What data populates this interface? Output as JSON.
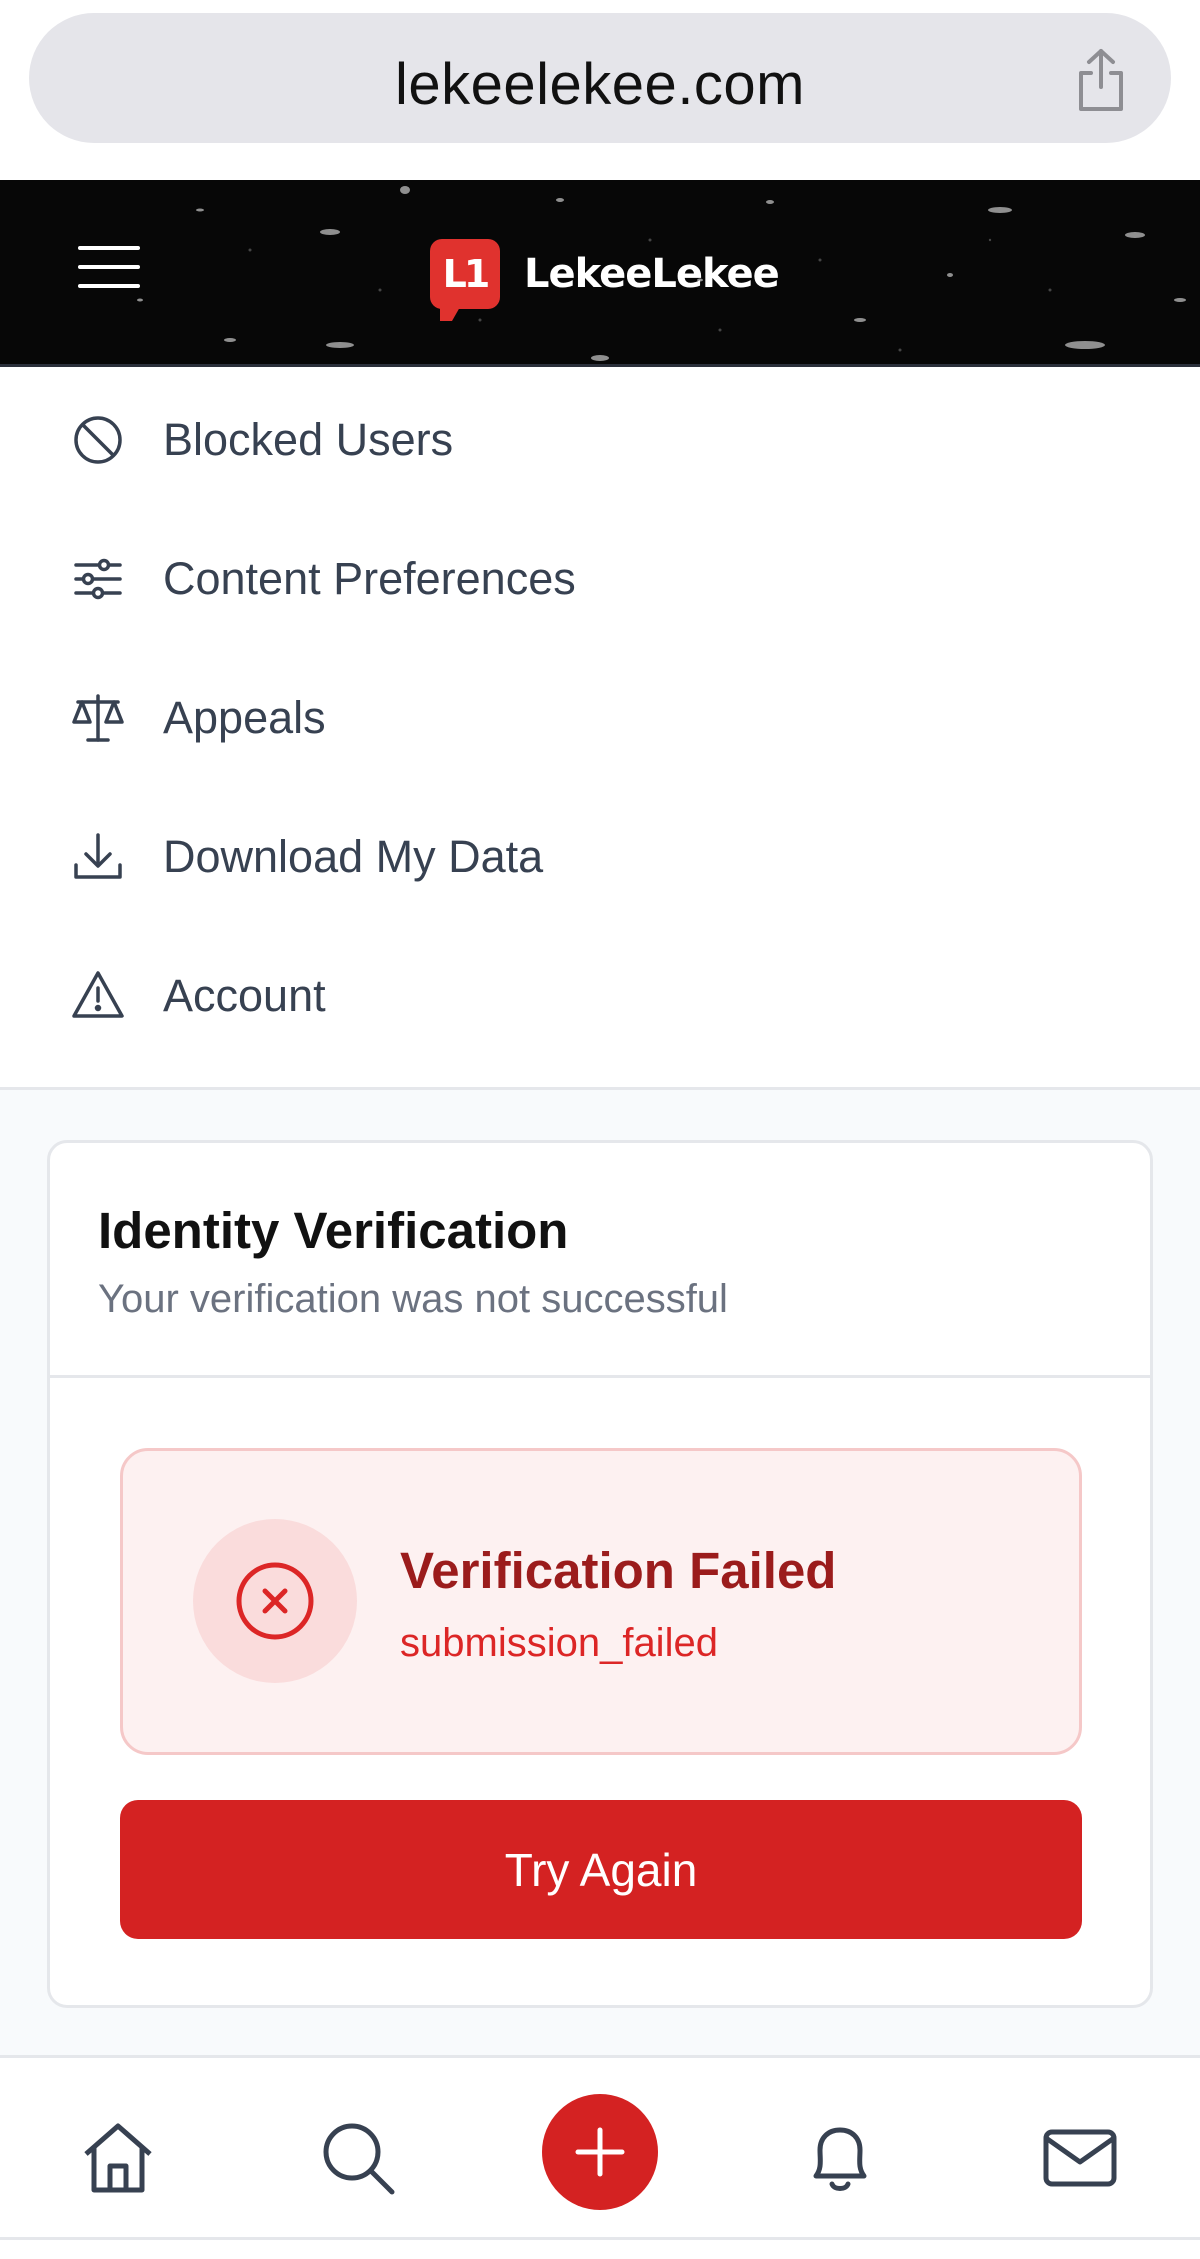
{
  "browser": {
    "url": "lekeelekee.com",
    "share_icon": "share-icon"
  },
  "header": {
    "menu_icon": "hamburger-icon",
    "logo_text": "LekeeLekee",
    "background": "#070707",
    "brand_color": "#e0322e"
  },
  "menu": {
    "items": [
      {
        "label": "Blocked Users",
        "icon": "block-icon"
      },
      {
        "label": "Content Preferences",
        "icon": "sliders-icon"
      },
      {
        "label": "Appeals",
        "icon": "scales-icon"
      },
      {
        "label": "Download My Data",
        "icon": "download-icon"
      },
      {
        "label": "Account",
        "icon": "warning-icon"
      }
    ]
  },
  "verification": {
    "title": "Identity Verification",
    "subtitle": "Your verification was not successful",
    "alert": {
      "title": "Verification Failed",
      "code": "submission_failed",
      "icon": "x-circle-icon",
      "color": "#dc2626"
    },
    "button_label": "Try Again",
    "button_color": "#d42222"
  },
  "bottom_nav": {
    "items": [
      {
        "icon": "home-icon"
      },
      {
        "icon": "search-icon"
      },
      {
        "icon": "plus-icon"
      },
      {
        "icon": "bell-icon"
      },
      {
        "icon": "mail-icon"
      }
    ]
  }
}
